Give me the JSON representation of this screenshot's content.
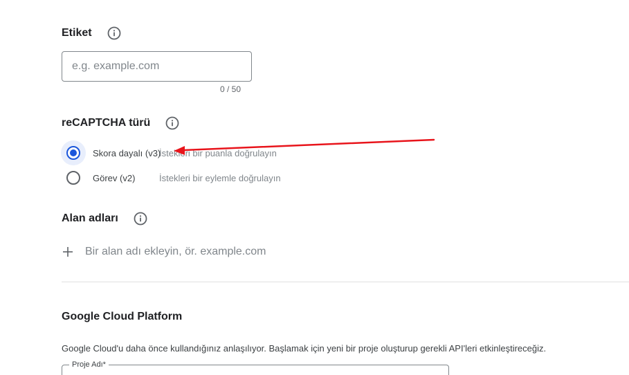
{
  "label_section": {
    "title": "Etiket",
    "input_placeholder": "e.g. example.com",
    "input_value": "",
    "counter": "0 / 50"
  },
  "recaptcha_section": {
    "title": "reCAPTCHA türü",
    "options": [
      {
        "label": "Skora dayalı (v3)",
        "description": "İstekleri bir puanla doğrulayın",
        "selected": true
      },
      {
        "label": "Görev (v2)",
        "description": "İstekleri bir eylemle doğrulayın",
        "selected": false
      }
    ]
  },
  "domains_section": {
    "title": "Alan adları",
    "add_placeholder": "Bir alan adı ekleyin, ör. example.com"
  },
  "gcp_section": {
    "title": "Google Cloud Platform",
    "description": "Google Cloud'u daha önce kullandığınız anlaşılıyor. Başlamak için yeni bir proje oluşturup gerekli API'leri etkinleştireceğiz.",
    "project_field_label": "Proje Adı*"
  },
  "annotation": {
    "arrow_color": "#e8141b"
  },
  "colors": {
    "accent": "#1a56db",
    "muted": "#80868b"
  }
}
